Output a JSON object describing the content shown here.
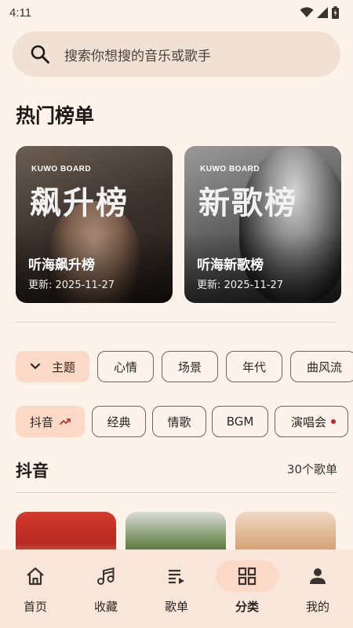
{
  "status_bar": {
    "time": "4:11",
    "icons": [
      "wifi-icon",
      "signal-icon",
      "battery-icon"
    ]
  },
  "search": {
    "placeholder": "搜索你想搜的音乐或歌手",
    "icon": "search-icon"
  },
  "hot_charts": {
    "title": "热门榜单",
    "cards": [
      {
        "brand": "KUWO BOARD",
        "cover_title": "飙升榜",
        "name": "听海飙升榜",
        "updated": "更新: 2025-11-27"
      },
      {
        "brand": "KUWO BOARD",
        "cover_title": "新歌榜",
        "name": "听海新歌榜",
        "updated": "更新: 2025-11-27"
      }
    ]
  },
  "category_chips": [
    {
      "label": "主题",
      "icon": "chevron-down-icon",
      "active": true
    },
    {
      "label": "心情"
    },
    {
      "label": "场景"
    },
    {
      "label": "年代"
    },
    {
      "label": "曲风流"
    }
  ],
  "tag_chips": [
    {
      "label": "抖音",
      "icon": "trending-up-icon",
      "active": true
    },
    {
      "label": "经典"
    },
    {
      "label": "情歌"
    },
    {
      "label": "BGM"
    },
    {
      "label": "演唱会",
      "dot": true
    }
  ],
  "playlist_section": {
    "title": "抖音",
    "count": "30个歌单"
  },
  "bottom_nav": [
    {
      "label": "首页",
      "icon": "home-icon"
    },
    {
      "label": "收藏",
      "icon": "music-note-icon"
    },
    {
      "label": "歌单",
      "icon": "playlist-icon"
    },
    {
      "label": "分类",
      "icon": "grid-icon",
      "active": true
    },
    {
      "label": "我的",
      "icon": "person-icon"
    }
  ],
  "colors": {
    "background": "#fdf3ea",
    "search_bg": "#f1e1d4",
    "accent_chip": "#fbd9c6",
    "nav_bg": "#f8e6da",
    "dot": "#c0282d"
  }
}
